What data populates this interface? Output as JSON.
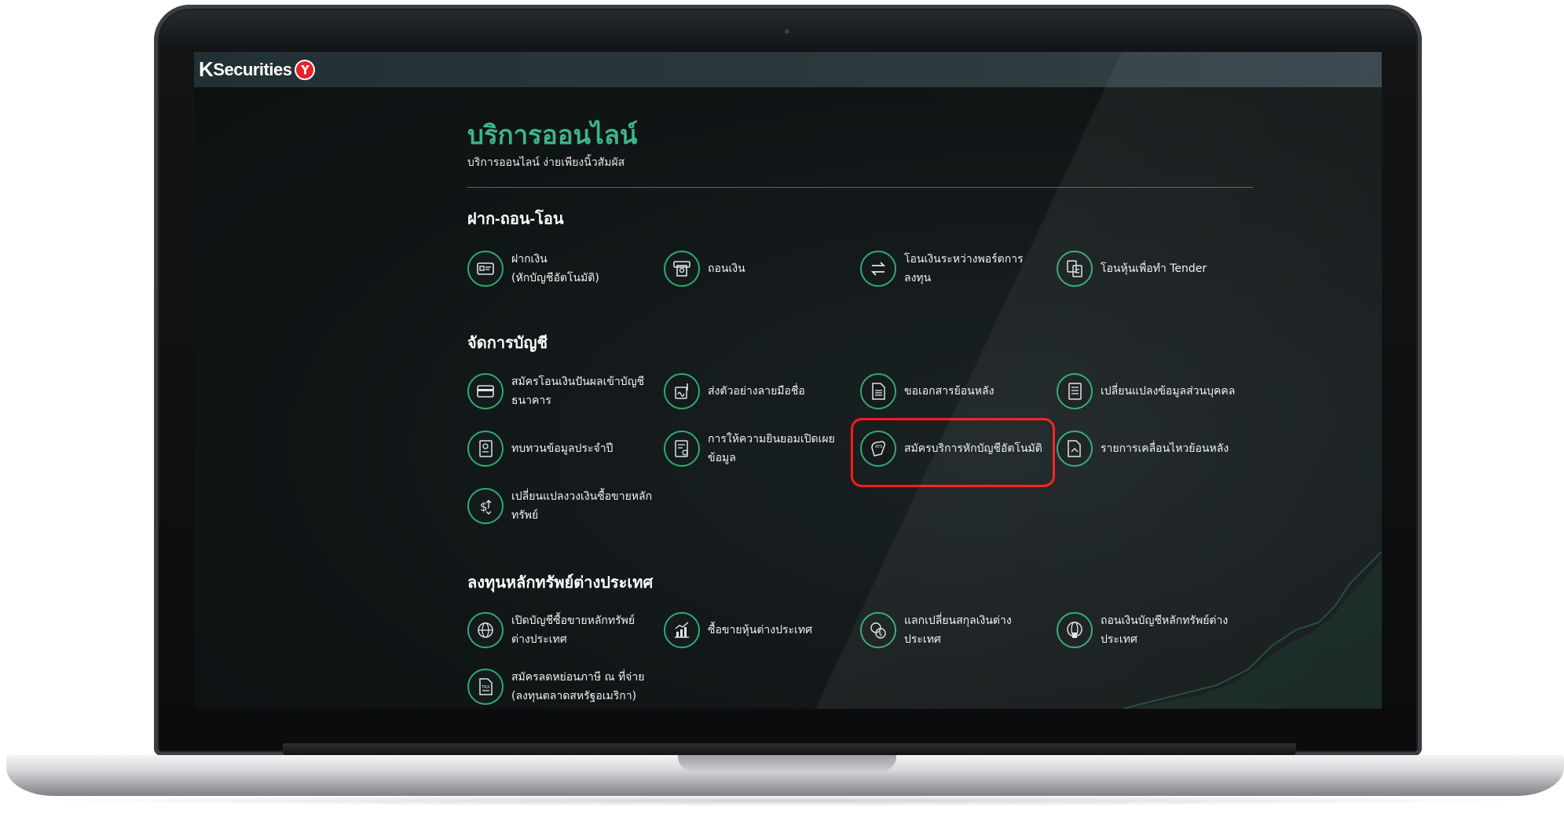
{
  "brand": {
    "logo_k": "K",
    "logo_text": "Securities"
  },
  "page": {
    "title": "บริการออนไลน์",
    "subtitle": "บริการออนไลน์ ง่ายเพียงนิ้วสัมผัส"
  },
  "sections": [
    {
      "title": "ฝาก-ถอน-โอน",
      "items": [
        {
          "label": "ฝากเงิน\n(หักบัญชีอัตโนมัติ)",
          "icon": "cash-card-icon"
        },
        {
          "label": "ถอนเงิน",
          "icon": "atm-withdraw-icon"
        },
        {
          "label": "โอนเงินระหว่างพอร์ตการ\nลงทุน",
          "icon": "transfer-arrows-icon"
        },
        {
          "label": "โอนหุ้นเพื่อทำ Tender",
          "icon": "share-transfer-icon"
        }
      ]
    },
    {
      "title": "จัดการบัญชี",
      "items": [
        {
          "label": "สมัครโอนเงินปันผลเข้าบัญชี\nธนาคาร",
          "icon": "bank-card-icon"
        },
        {
          "label": "ส่งตัวอย่างลายมือชื่อ",
          "icon": "signature-icon"
        },
        {
          "label": "ขอเอกสารย้อนหลัง",
          "icon": "document-icon"
        },
        {
          "label": "เปลี่ยนแปลงข้อมูลส่วนบุคคล",
          "icon": "profile-document-icon"
        },
        {
          "label": "ทบทวนข้อมูลประจำปี",
          "icon": "review-profile-icon"
        },
        {
          "label": "การให้ความยินยอมเปิดเผย\nข้อมูล",
          "icon": "consent-document-icon"
        },
        {
          "label": "สมัครบริการหักบัญชีอัตโนมัติ",
          "icon": "ats-icon",
          "highlighted": true
        },
        {
          "label": "รายการเคลื่อนไหวย้อนหลัง",
          "icon": "statement-history-icon"
        },
        {
          "label": "เปลี่ยนแปลงวงเงินซื้อขายหลัก\nทรัพย์",
          "icon": "dollar-exchange-icon"
        }
      ]
    },
    {
      "title": "ลงทุนหลักทรัพย์ต่างประเทศ",
      "items": [
        {
          "label": "เปิดบัญชีซื้อขายหลักทรัพย์\nต่างประเทศ",
          "icon": "globe-icon"
        },
        {
          "label": "ซื้อขายหุ้นต่างประเทศ",
          "icon": "stock-chart-icon"
        },
        {
          "label": "แลกเปลี่ยนสกุลเงินต่างประเทศ",
          "icon": "currency-exchange-icon"
        },
        {
          "label": "ถอนเงินบัญชีหลักทรัพย์ต่าง\nประเทศ",
          "icon": "globe-withdraw-icon"
        },
        {
          "label": "สมัครลดหย่อนภาษี ณ ที่จ่าย\n(ลงทุนตลาดสหรัฐอเมริกา)",
          "icon": "tax-document-icon"
        }
      ]
    }
  ],
  "colors": {
    "accent": "#3cb58a",
    "icon_ring": "#2fa86f",
    "highlight": "#ff1a1a"
  }
}
